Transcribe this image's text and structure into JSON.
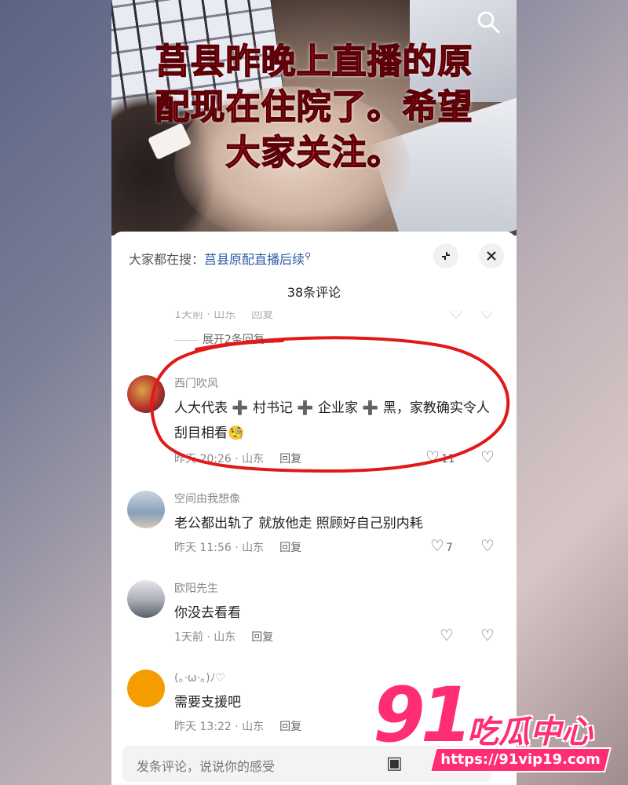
{
  "video": {
    "caption_lines": [
      "莒县昨晚上直播的原",
      "配现在住院了。希望",
      "大家关注。"
    ]
  },
  "sheet": {
    "hot_search_prefix": "大家都在搜：",
    "hot_search_term": "莒县原配直播后续",
    "title": "38条评论",
    "ghost_meta": "1天前 · 山东",
    "ghost_reply": "回复",
    "expand_label": "展开2条回复"
  },
  "comments": [
    {
      "username": "西门吹风",
      "text": "人大代表 ➕ 村书记 ➕ 企业家 ➕ 黑，家教确实令人刮目相看🧐",
      "time": "昨天 20:26 · 山东",
      "reply": "回复",
      "likes": "11",
      "avatar_color": "#b8322a"
    },
    {
      "username": "空间由我想像",
      "text": "老公都出轨了 就放他走 照顾好自己别内耗",
      "time": "昨天 11:56 · 山东",
      "reply": "回复",
      "likes": "7",
      "avatar_color": "#8aa0b8"
    },
    {
      "username": "欧阳先生",
      "text": "你没去看看",
      "time": "1天前 · 山东",
      "reply": "回复",
      "likes": "",
      "avatar_color": "#cfd2d8"
    },
    {
      "username": "(。·ω·。)ﾉ♡",
      "text": "需要支援吧",
      "time": "昨天 13:22 · 山东",
      "reply": "回复",
      "likes": "",
      "avatar_color": "#f59c00"
    }
  ],
  "input": {
    "placeholder": "发条评论，说说你的感受"
  },
  "watermark": {
    "number": "91",
    "brand": "吃瓜中心",
    "url": "https://91vip19.com"
  },
  "colors": {
    "caption_red": "#e8222b",
    "link_blue": "#2b59a3",
    "annotation_red": "#e01919",
    "watermark_pink": "#ff2d74"
  }
}
